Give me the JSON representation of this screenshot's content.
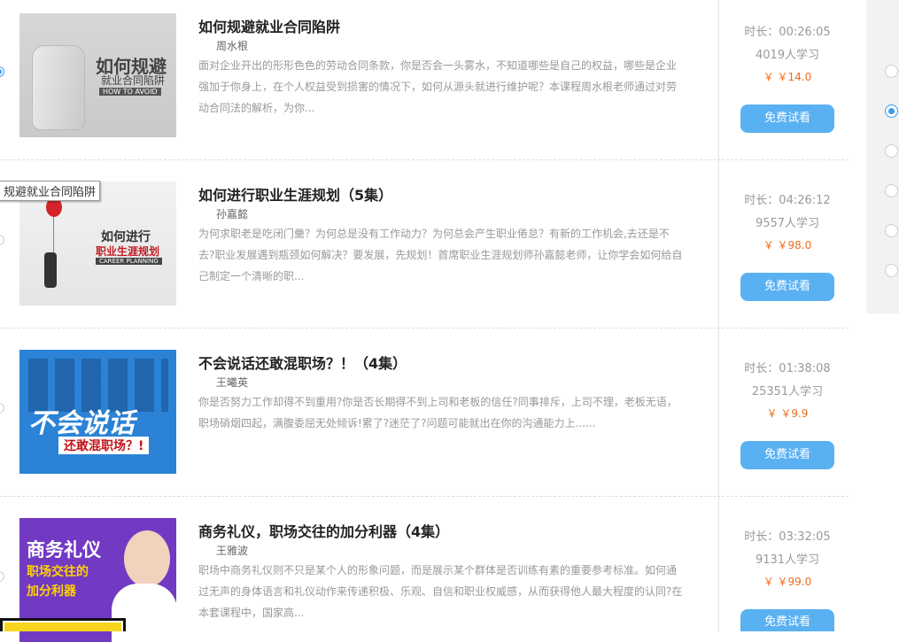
{
  "tooltip": "规避就业合同陷阱",
  "try_label": "免费试看",
  "courses": [
    {
      "title": "如何规避就业合同陷阱",
      "author": "周水根",
      "desc": "面对企业开出的形形色色的劳动合同条款，你是否会一头雾水，不知道哪些是自己的权益，哪些是企业强加于你身上，在个人权益受到损害的情况下，如何从源头就进行维护呢？本课程周水根老师通过对劳动合同法的解析，为你...",
      "duration": "时长：00:26:05",
      "learners": "4019人学习",
      "price": "￥ ￥14.0",
      "thumb": {
        "line1": "如何规避",
        "line2": "就业合同陷阱",
        "line3": "HOW TO AVOID"
      }
    },
    {
      "title": "如何进行职业生涯规划（5集）",
      "author": "孙嘉懿",
      "desc": "为何求职老是吃闭门羹？为何总是没有工作动力？为何总会产生职业倦怠？有新的工作机会,去还是不去?职业发展遇到瓶颈如何解决？要发展，先规划！首席职业生涯规划师孙嘉懿老师，让你学会如何给自己制定一个清晰的职...",
      "duration": "时长：04:26:12",
      "learners": "9557人学习",
      "price": "￥ ￥98.0",
      "thumb": {
        "line1": "如何进行",
        "line2": "职业生涯规划",
        "line3": "CAREER PLANNING"
      }
    },
    {
      "title": "不会说话还敢混职场？！（4集）",
      "author": "王曦英",
      "desc": "你是否努力工作却得不到重用?你是否长期得不到上司和老板的信任?同事排斥，上司不理，老板无语，职场硝烟四起，满腹委屈无处倾诉!累了?迷茫了?问题可能就出在你的沟通能力上......",
      "duration": "时长：01:38:08",
      "learners": "25351人学习",
      "price": "￥ ￥9.9",
      "thumb": {
        "line1": "不会说话",
        "line2": "还敢混职场？!",
        "line3": ""
      }
    },
    {
      "title": "商务礼仪，职场交往的加分利器（4集）",
      "author": "王雅波",
      "desc": "职场中商务礼仪则不只是某个人的形象问题，而是展示某个群体是否训练有素的重要参考标准。如何通过无声的身体语言和礼仪动作来传递积极、乐观、自信和职业权威感，从而获得他人最大程度的认同?在本套课程中，国家高...",
      "duration": "时长：03:32:05",
      "learners": "9131人学习",
      "price": "￥ ￥99.0",
      "thumb": {
        "line1": "商务礼仪",
        "line2": "职场交往的",
        "line3": "加分利器"
      }
    }
  ]
}
